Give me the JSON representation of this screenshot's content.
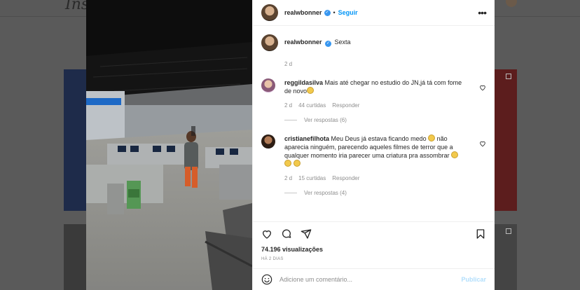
{
  "background": {
    "logo_text": "Insta"
  },
  "post": {
    "username": "realwbonner",
    "follow_label": "Seguir",
    "caption": "Sexta",
    "caption_time": "2 d",
    "comments": [
      {
        "username": "reggildasilva",
        "text": "Mais até chegar no estudio do JN,já tá com fome de novo",
        "time": "2 d",
        "likes": "44 curtidas",
        "reply_label": "Responder",
        "view_replies": "Ver respostas (6)"
      },
      {
        "username": "cristianefilhota",
        "text": "Meu Deus já estava ficando medo",
        "text_2": "não aparecia ninguém, parecendo aqueles filmes de terror que a qualquer momento iria parecer uma criatura pra assombrar",
        "time": "2 d",
        "likes": "15 curtidas",
        "reply_label": "Responder",
        "view_replies": "Ver respostas (4)"
      }
    ],
    "views": "74.196 visualizações",
    "posted_ago": "HÁ 2 DIAS",
    "comment_placeholder": "Adicione um comentário...",
    "publish_label": "Publicar"
  },
  "colors": {
    "accent": "#0095f6",
    "verified": "#3897f0",
    "publish_disabled": "#b2dffc"
  }
}
